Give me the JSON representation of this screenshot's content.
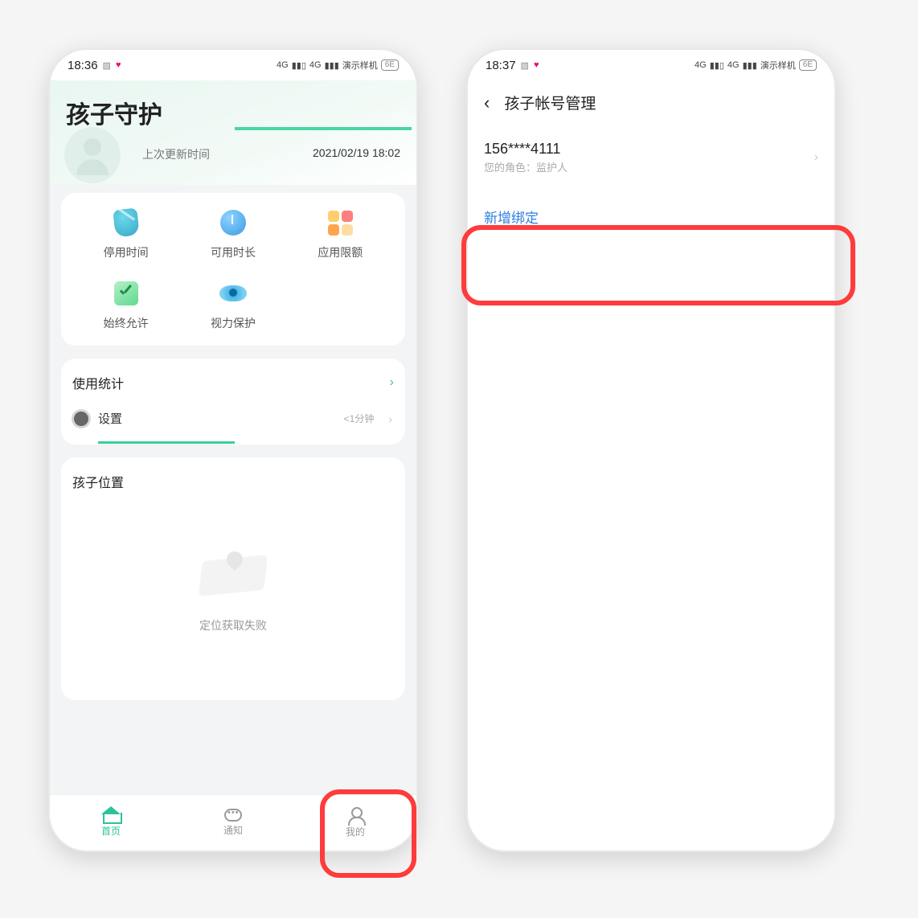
{
  "left": {
    "status": {
      "time": "18:36",
      "device": "演示样机",
      "battery": "6E",
      "net1": "4G",
      "net2": "4G"
    },
    "app_title": "孩子守护",
    "update_label": "上次更新时间",
    "update_time": "2021/02/19 18:02",
    "features": {
      "downtime": "停用时间",
      "available": "可用时长",
      "app_quota": "应用限额",
      "always_allow": "始终允许",
      "eye_protect": "视力保护"
    },
    "usage": {
      "title": "使用统计",
      "item_name": "设置",
      "item_duration": "<1分钟"
    },
    "location": {
      "title": "孩子位置",
      "fail_text": "定位获取失败"
    },
    "nav": {
      "home": "首页",
      "notice": "通知",
      "mine": "我的"
    }
  },
  "right": {
    "status": {
      "time": "18:37",
      "device": "演示样机",
      "battery": "6E",
      "net1": "4G",
      "net2": "4G"
    },
    "page_title": "孩子帐号管理",
    "account": {
      "phone": "156****4111",
      "role_label": "您的角色：监护人"
    },
    "add_bind": "新增绑定"
  }
}
